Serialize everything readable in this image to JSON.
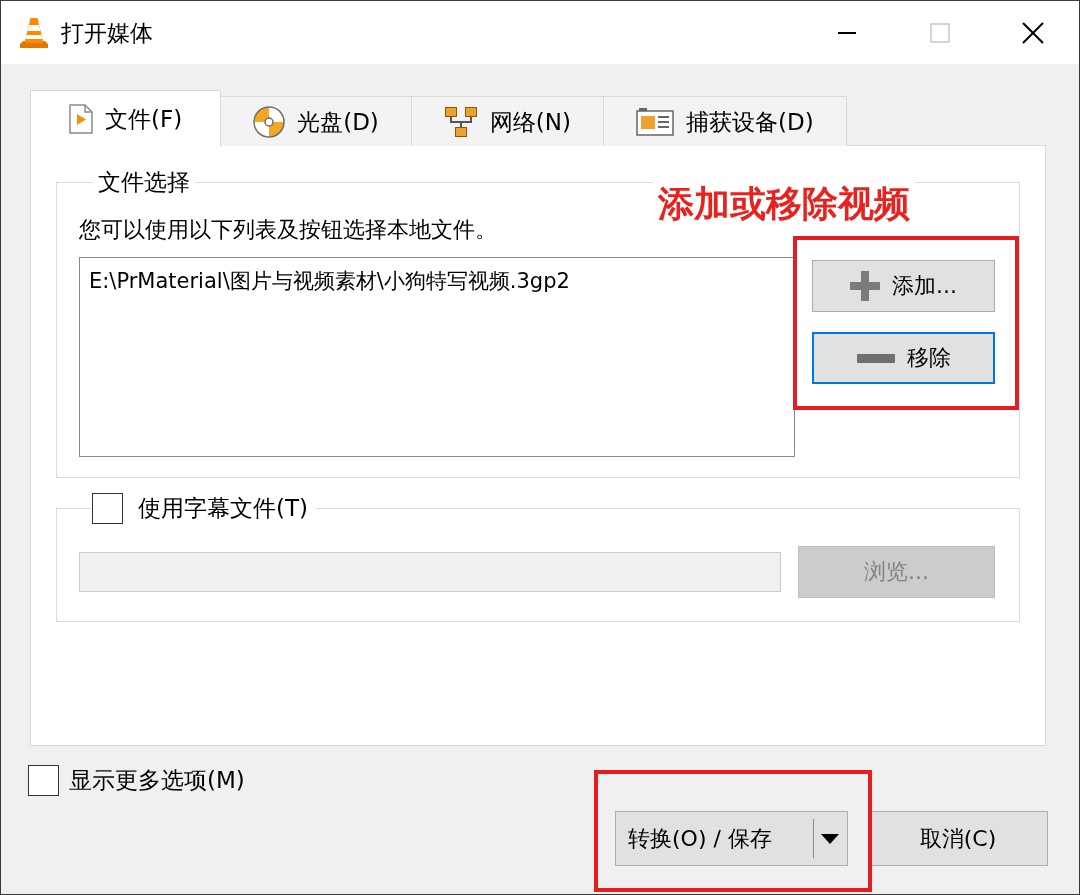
{
  "window": {
    "title": "打开媒体",
    "maximize_disabled": true
  },
  "tabs": [
    {
      "label": "文件(F)",
      "kind": "file",
      "selected": true
    },
    {
      "label": "光盘(D)",
      "kind": "disc",
      "selected": false
    },
    {
      "label": "网络(N)",
      "kind": "network",
      "selected": false
    },
    {
      "label": "捕获设备(D)",
      "kind": "capture",
      "selected": false
    }
  ],
  "file_selection": {
    "title": "文件选择",
    "description": "您可以使用以下列表及按钮选择本地文件。",
    "callout": "添加或移除视频",
    "files": [
      {
        "path": "E:\\PrMaterial\\图片与视频素材\\小狗特写视频.3gp2",
        "selected": false
      }
    ],
    "buttons": [
      {
        "label": "添加...",
        "kind": "add",
        "focused": false
      },
      {
        "label": "移除",
        "kind": "remove",
        "focused": true
      }
    ],
    "buttons_highlighted": true
  },
  "subtitle": {
    "label": "使用字幕文件(T)",
    "checked": false,
    "field_disabled": true,
    "browse": {
      "label": "浏览...",
      "disabled": true
    }
  },
  "show_more": {
    "label": "显示更多选项(M)",
    "checked": false
  },
  "footer": {
    "highlighted": true,
    "buttons": [
      {
        "label": "转换(O) / 保存",
        "kind": "split"
      },
      {
        "label": "取消(C)",
        "kind": "plain"
      }
    ]
  }
}
